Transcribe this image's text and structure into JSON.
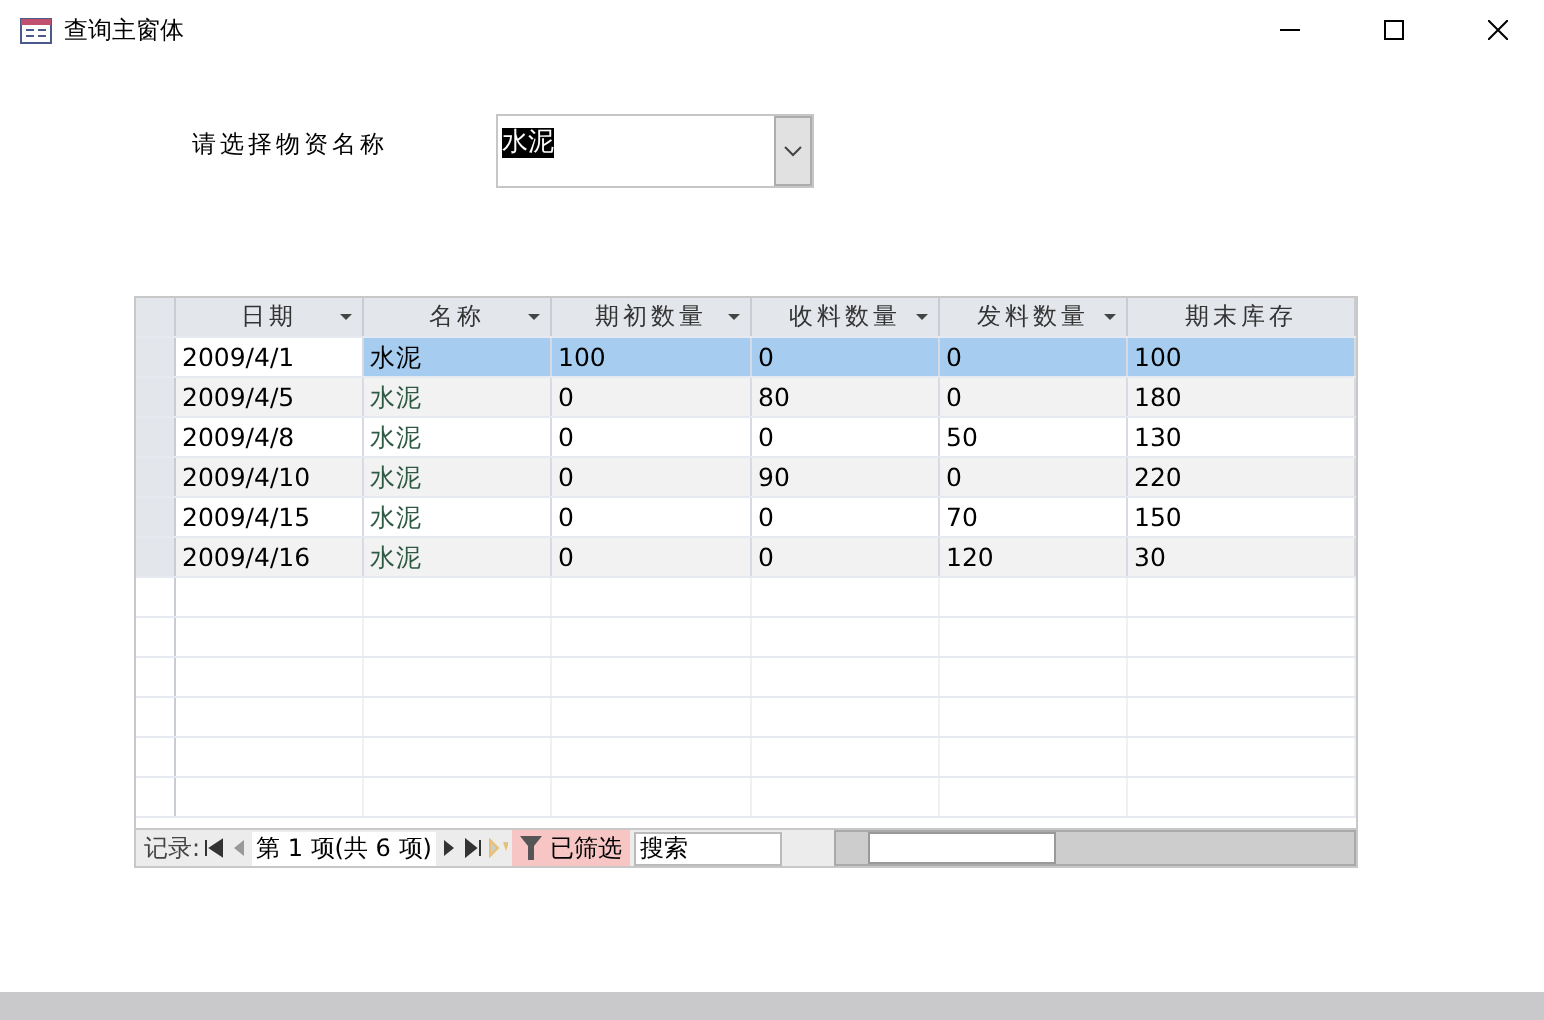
{
  "window": {
    "title": "查询主窗体"
  },
  "filter": {
    "label": "请选择物资名称",
    "value": "水泥"
  },
  "table": {
    "columns": [
      {
        "label": "日期",
        "filter_arrow": true
      },
      {
        "label": "名称",
        "filter_arrow": true
      },
      {
        "label": "期初数量",
        "filter_arrow": true
      },
      {
        "label": "收料数量",
        "filter_arrow": true
      },
      {
        "label": "发料数量",
        "filter_arrow": true
      },
      {
        "label": "期末库存",
        "filter_arrow": false
      }
    ],
    "rows": [
      {
        "selected": true,
        "cells": [
          "2009/4/1",
          "水泥",
          "100",
          "0",
          "0",
          "100"
        ]
      },
      {
        "selected": false,
        "cells": [
          "2009/4/5",
          "水泥",
          "0",
          "80",
          "0",
          "180"
        ]
      },
      {
        "selected": false,
        "cells": [
          "2009/4/8",
          "水泥",
          "0",
          "0",
          "50",
          "130"
        ]
      },
      {
        "selected": false,
        "cells": [
          "2009/4/10",
          "水泥",
          "0",
          "90",
          "0",
          "220"
        ]
      },
      {
        "selected": false,
        "cells": [
          "2009/4/15",
          "水泥",
          "0",
          "0",
          "70",
          "150"
        ]
      },
      {
        "selected": false,
        "cells": [
          "2009/4/16",
          "水泥",
          "0",
          "0",
          "120",
          "30"
        ]
      }
    ]
  },
  "navigator": {
    "label": "记录:",
    "position": "第 1 项(共 6 项)",
    "filtered": "已筛选",
    "search": "搜索"
  }
}
